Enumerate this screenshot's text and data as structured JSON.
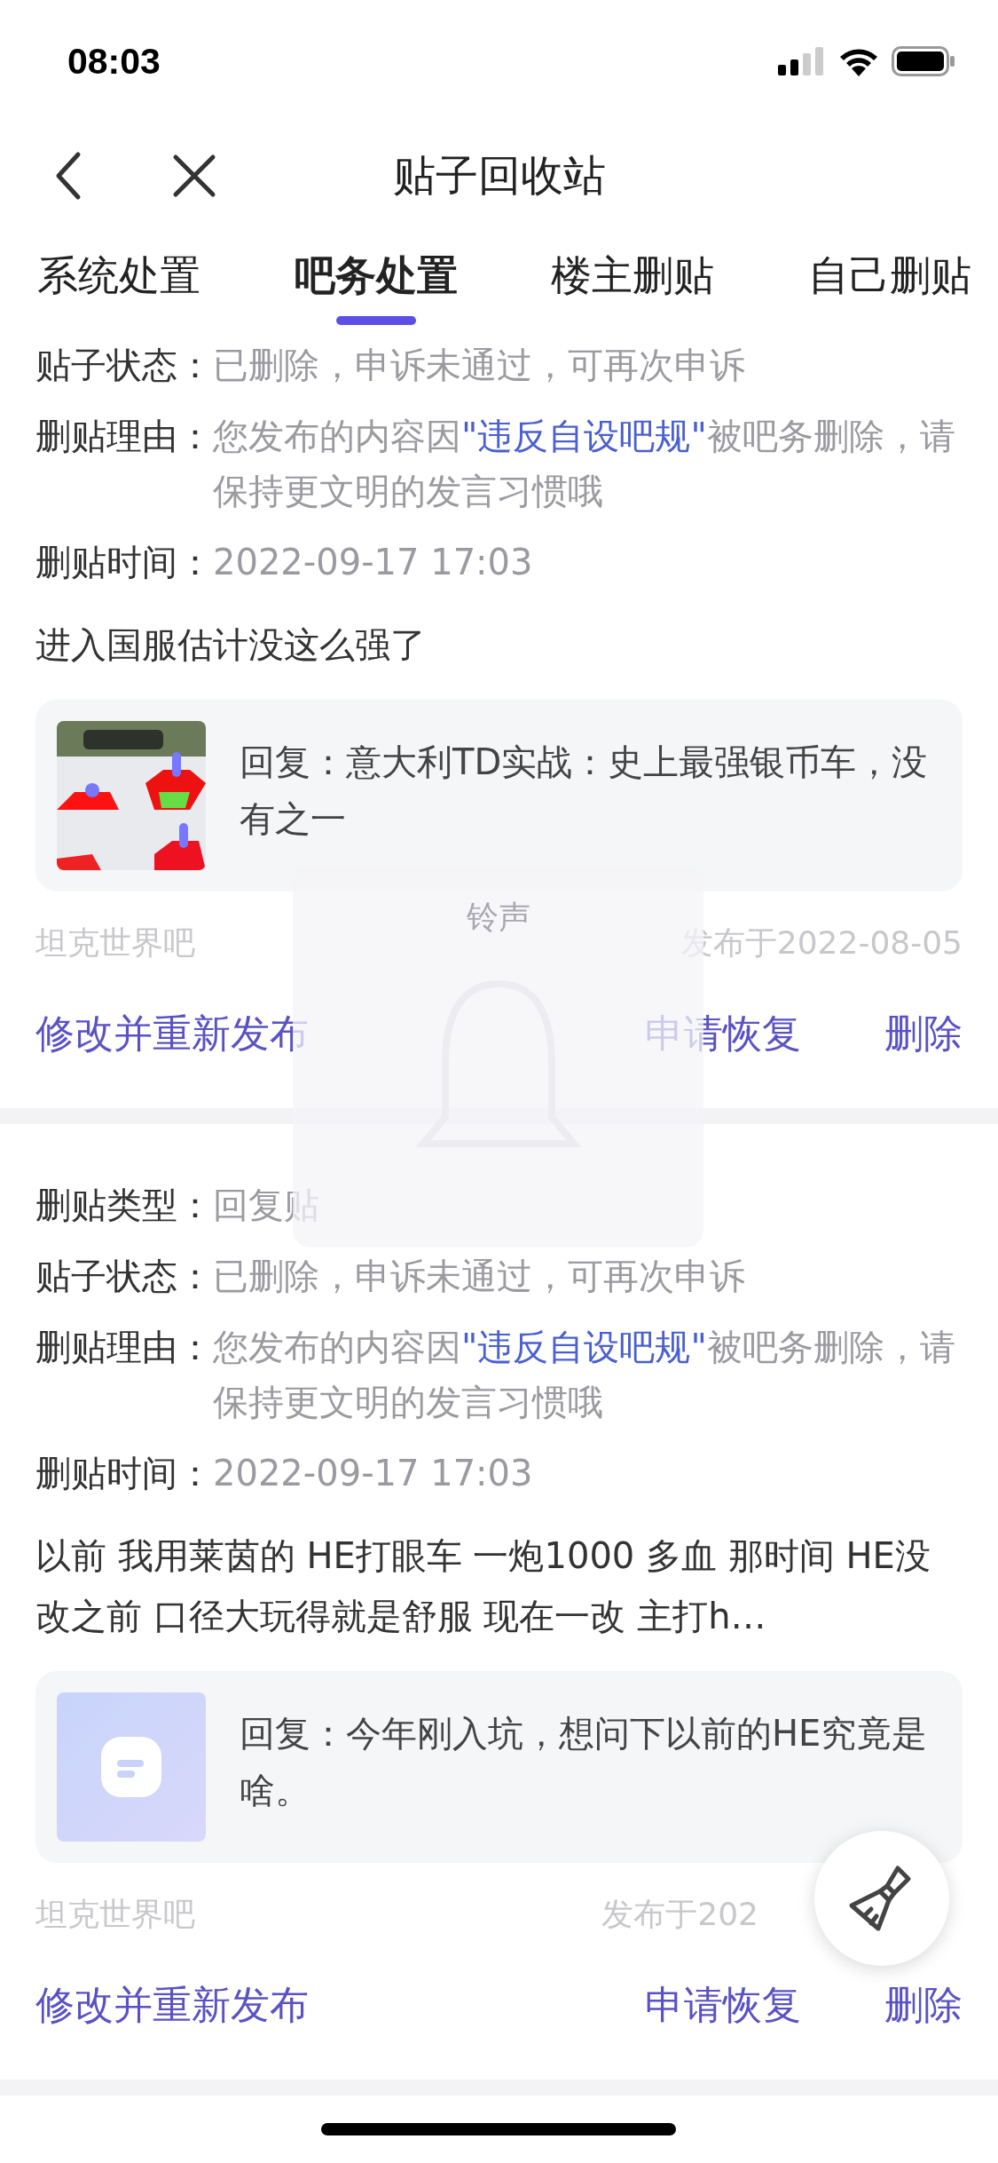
{
  "status_bar": {
    "time": "08:03"
  },
  "nav": {
    "title": "贴子回收站"
  },
  "tabs": [
    {
      "label": "系统处置",
      "selected": false
    },
    {
      "label": "吧务处置",
      "selected": true
    },
    {
      "label": "楼主删贴",
      "selected": false
    },
    {
      "label": "自己删贴",
      "selected": false
    }
  ],
  "posts": [
    {
      "fields": [
        {
          "kind": "text",
          "label": "贴子状态：",
          "value": "已删除，申诉未通过，可再次申诉"
        },
        {
          "kind": "rule",
          "label": "删贴理由：",
          "before": "您发布的内容因",
          "rule": "\"违反自设吧规\"",
          "after": "被吧务删除，请保持更文明的发言习惯哦"
        },
        {
          "kind": "text",
          "label": "删贴时间：",
          "value": "2022-09-17 17:03"
        }
      ],
      "body": "进入国服估计没这么强了",
      "reply": {
        "kind": "picture",
        "text": "回复：意大利TD实战：史上最强银币车，没有之一"
      },
      "forum": "坦克世界吧",
      "date": "发布于2022-08-05",
      "actions": [
        "修改并重新发布",
        "申请恢复",
        "删除"
      ]
    },
    {
      "fields": [
        {
          "kind": "text",
          "label": "删贴类型：",
          "value": "回复贴"
        },
        {
          "kind": "text",
          "label": "贴子状态：",
          "value": "已删除，申诉未通过，可再次申诉"
        },
        {
          "kind": "rule",
          "label": "删贴理由：",
          "before": "您发布的内容因",
          "rule": "\"违反自设吧规\"",
          "after": "被吧务删除，请保持更文明的发言习惯哦"
        },
        {
          "kind": "text",
          "label": "删贴时间：",
          "value": "2022-09-17 17:03"
        }
      ],
      "body": "以前 我用莱茵的 HE打眼车 一炮1000 多血 那时间 HE没改之前 口径大玩得就是舒服 现在一改 主打h…",
      "reply": {
        "kind": "placeholder",
        "text": "回复：今年刚入坑，想问下以前的HE究竟是啥。"
      },
      "forum": "坦克世界吧",
      "date": "发布于202",
      "actions": [
        "修改并重新发布",
        "申请恢复",
        "删除"
      ]
    }
  ],
  "volume_hud": {
    "title": "铃声"
  }
}
